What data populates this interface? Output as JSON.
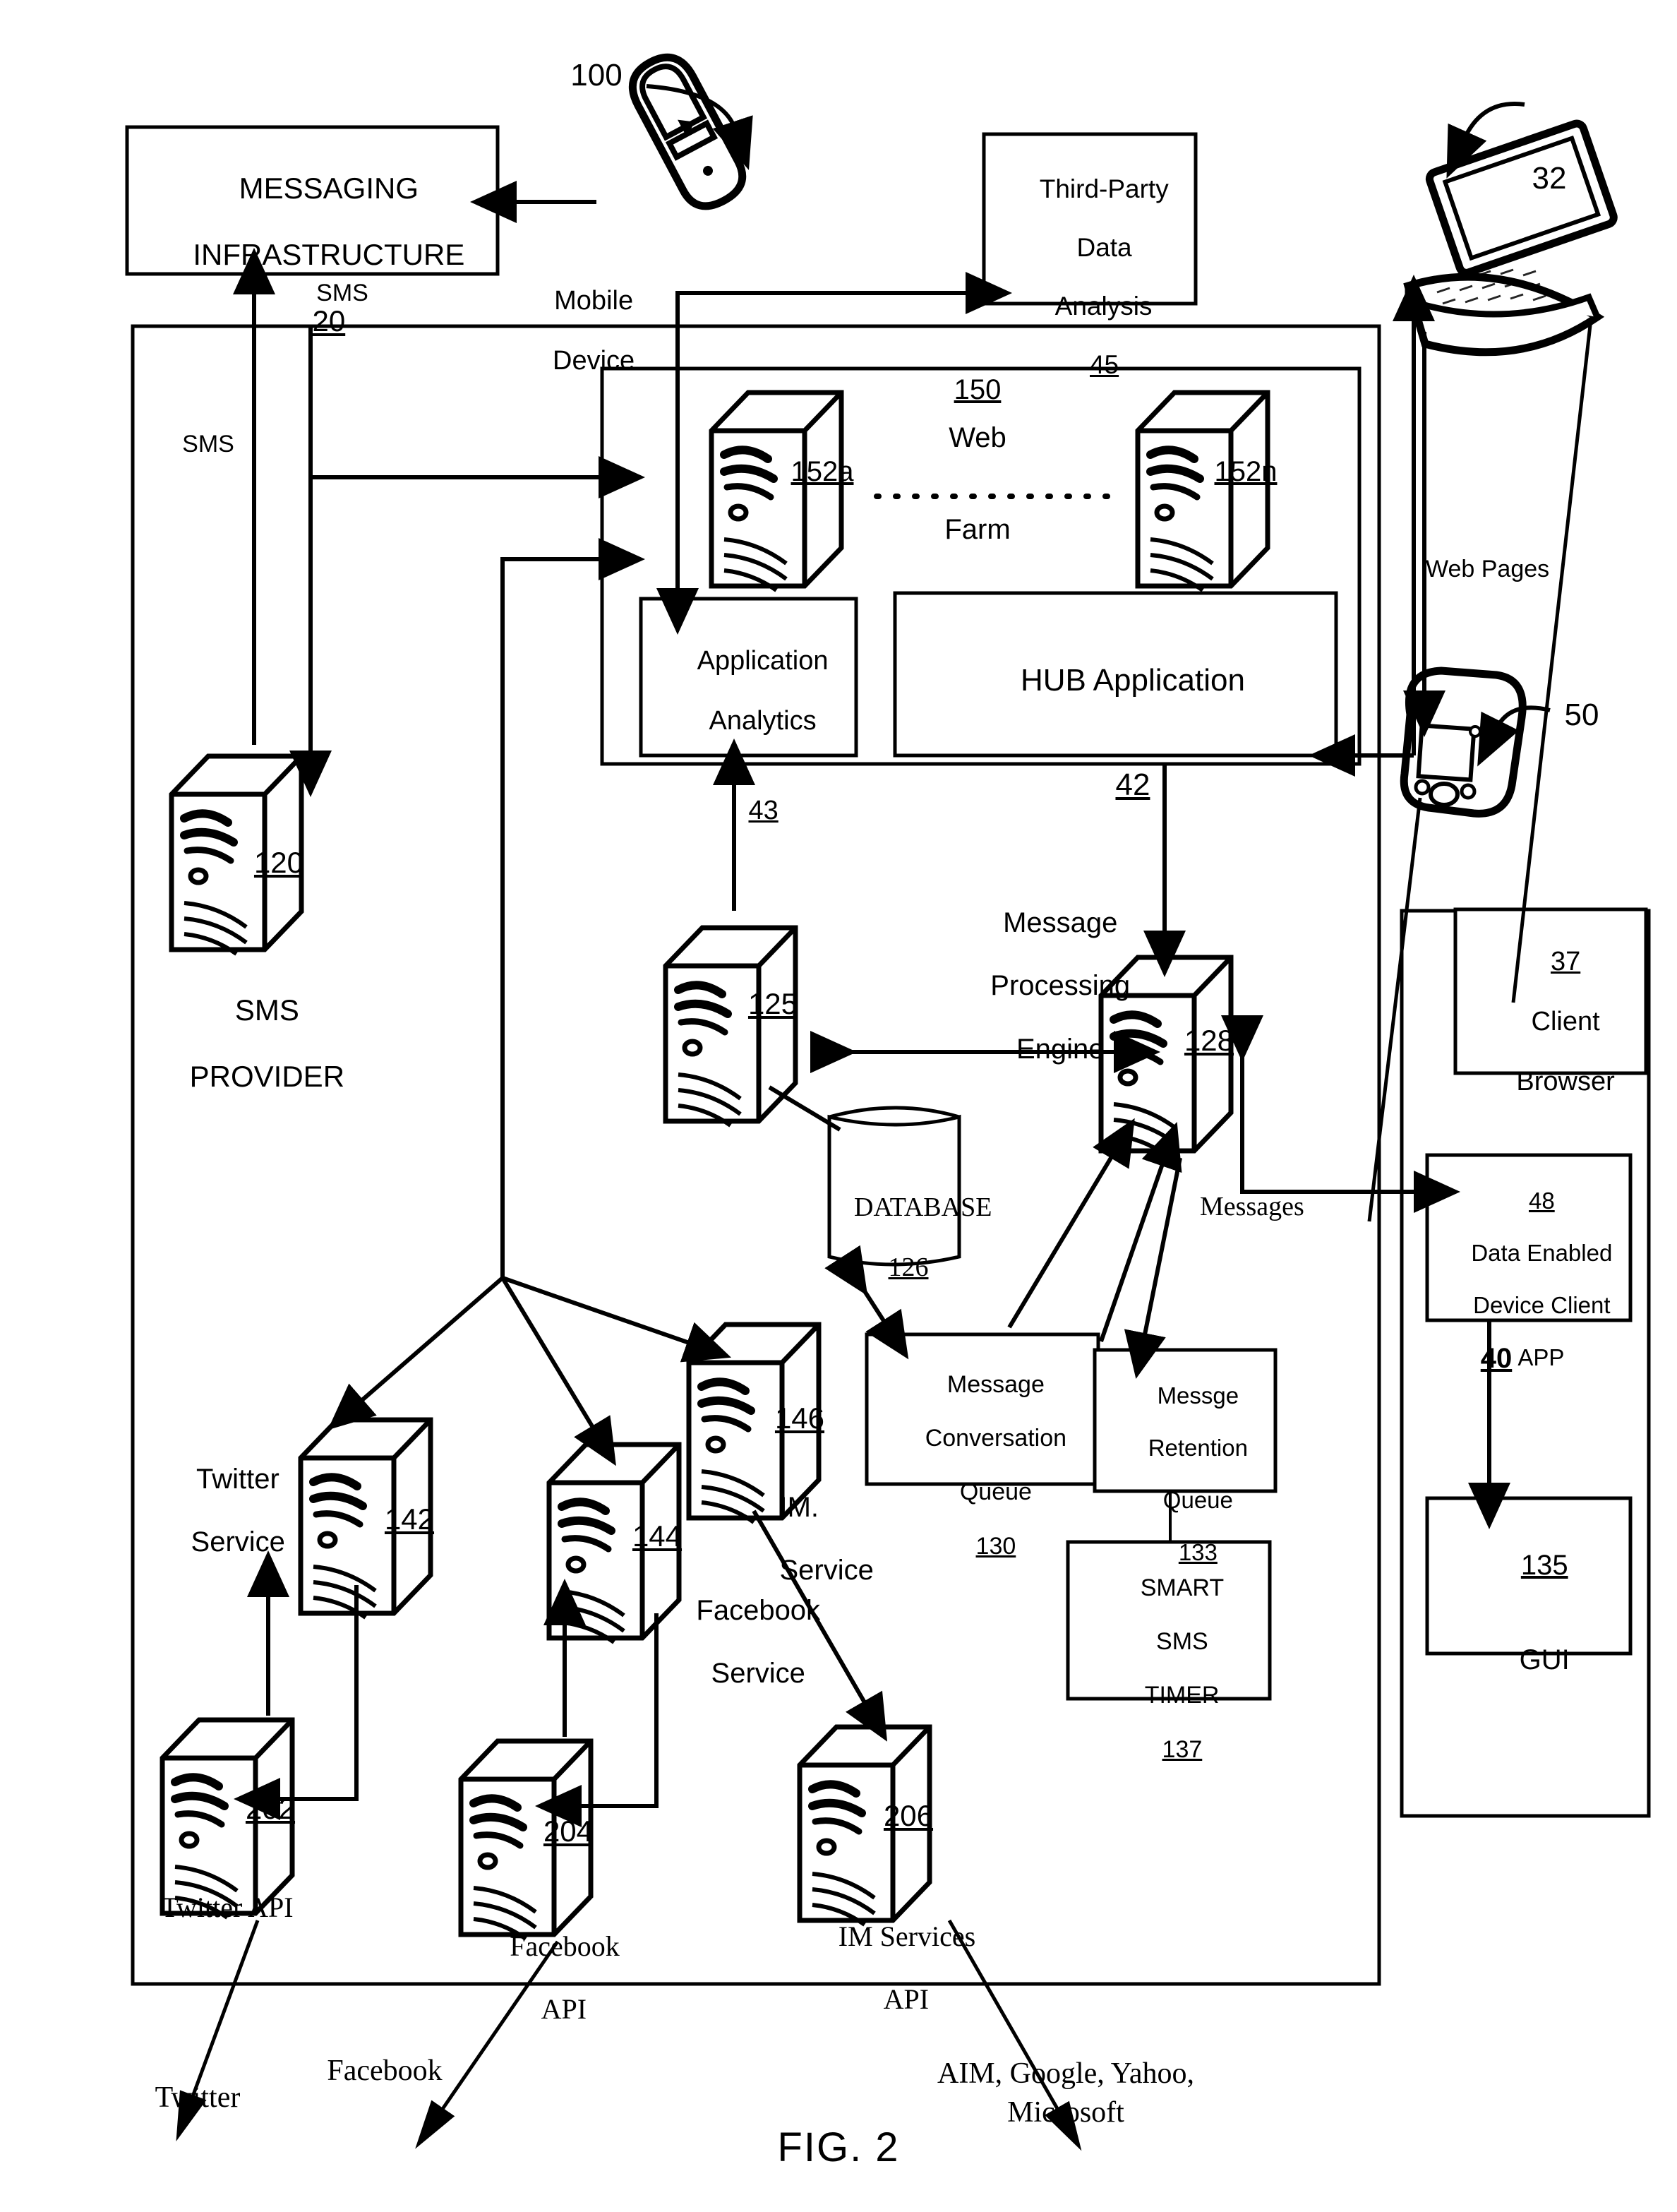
{
  "figure": {
    "caption": "FIG. 2"
  },
  "nodes": {
    "messaging_infrastructure": {
      "title_line1": "MESSAGING",
      "title_line2": "INFRASTRUCTURE",
      "ref": "20"
    },
    "mobile_device": {
      "label_line1": "Mobile",
      "label_line2": "Device",
      "ref": "100"
    },
    "third_party": {
      "line1": "Third-Party",
      "line2": "Data",
      "line3": "Analysis",
      "ref": "45"
    },
    "laptop": {
      "ref": "32"
    },
    "handheld": {
      "ref": "50"
    },
    "web_farm": {
      "ref": "150",
      "line1": "Web",
      "line2": "Farm",
      "server_a": "152a",
      "server_n": "152n"
    },
    "application_analytics": {
      "line1": "Application",
      "line2": "Analytics",
      "ref": "43"
    },
    "hub_application": {
      "title": "HUB Application",
      "ref": "42"
    },
    "sms_provider": {
      "ref": "120",
      "line1": "SMS",
      "line2": "PROVIDER"
    },
    "server_125": {
      "ref": "125"
    },
    "message_processing_engine": {
      "line1": "Message",
      "line2": "Processing",
      "line3": "Engine",
      "ref": "128"
    },
    "database": {
      "title": "DATABASE",
      "ref": "126"
    },
    "message_conversation_queue": {
      "line1": "Message",
      "line2": "Conversation",
      "line3": "Queue",
      "ref": "130"
    },
    "message_retention_queue": {
      "line1": "Messge",
      "line2": "Retention",
      "line3": "Queue",
      "ref": "133"
    },
    "smart_sms_timer": {
      "line1": "SMART",
      "line2": "SMS",
      "line3": "TIMER",
      "ref": "137"
    },
    "twitter_service": {
      "line1": "Twitter",
      "line2": "Service",
      "ref": "142"
    },
    "facebook_service": {
      "line1": "Facebook",
      "line2": "Service",
      "ref": "144"
    },
    "im_service": {
      "line1": "IM.",
      "line2": "Service",
      "ref": "146"
    },
    "twitter_api": {
      "label": "Twitter API",
      "ref": "202"
    },
    "facebook_api": {
      "line1": "Facebook",
      "line2": "API",
      "ref": "204"
    },
    "im_services_api": {
      "line1": "IM Services",
      "line2": "API",
      "ref": "206"
    },
    "client_browser": {
      "ref": "37",
      "line1": "Client",
      "line2": "Browser"
    },
    "data_enabled_client": {
      "ref": "48",
      "line1": "Data Enabled",
      "line2": "Device Client",
      "line3": "APP"
    },
    "device_group": {
      "ref": "40"
    },
    "gui": {
      "ref": "135",
      "label": "GUI"
    }
  },
  "edge_labels": {
    "sms_top": "SMS",
    "sms_left": "SMS",
    "web_pages": "Web Pages",
    "messages": "Messages"
  },
  "external_labels": {
    "twitter": "Twitter",
    "facebook": "Facebook",
    "im_networks": "AIM, Google, Yahoo,\nMicrosoft"
  },
  "colors": {
    "ink": "#000000",
    "paper": "#ffffff"
  }
}
